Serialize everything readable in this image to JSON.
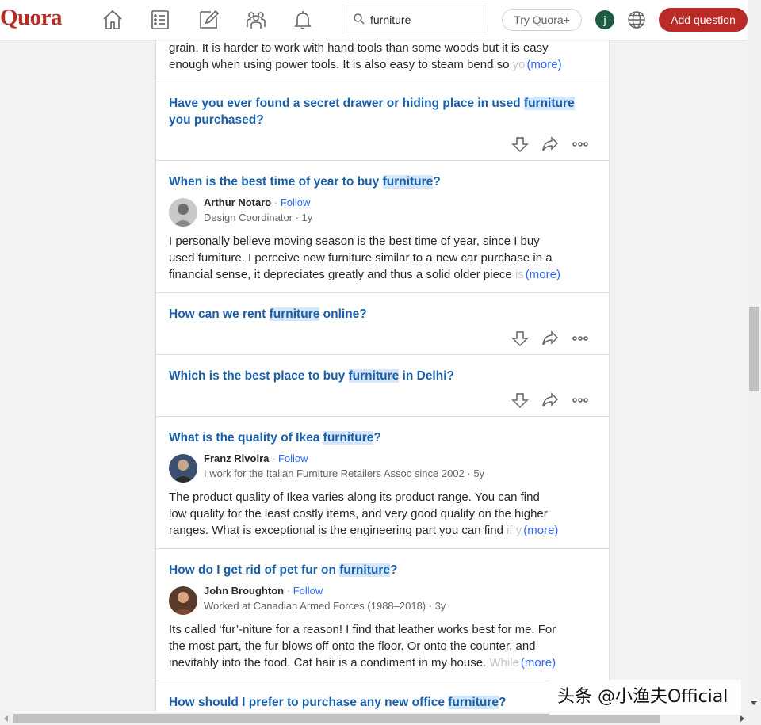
{
  "header": {
    "logo": "Quora",
    "nav_icons": [
      "home-icon",
      "following-icon",
      "answer-icon",
      "spaces-icon",
      "notifications-icon"
    ],
    "search": {
      "value": "furniture"
    },
    "try_label": "Try Quora+",
    "avatar_letter": "j",
    "add_question_label": "Add question",
    "colors": {
      "brand": "#b92b27",
      "link": "#195faa",
      "follow": "#2e69ff",
      "highlight": "#d6e6fb"
    }
  },
  "feed": {
    "top_snippet": {
      "line1": "grain. It is harder to work with hand tools than some woods but it is easy",
      "line2": "enough when using power tools. It is also easy to steam bend so ",
      "fade": "yo",
      "more": "(more)"
    },
    "items": [
      {
        "pre": "Have you ever found a secret drawer or hiding place in used ",
        "hl": "furniture",
        "post": " you purchased?"
      },
      {
        "pre": "When is the best time of year to buy ",
        "hl": "furniture",
        "post": "?",
        "author": "Arthur Notaro",
        "follow": "Follow",
        "cred": "Design Coordinator · 1y",
        "line1": "I personally believe moving season is the best time of year, since I buy",
        "line2": "used furniture. I perceive new furniture similar to a new car purchase in a",
        "line3": "financial sense, it depreciates greatly and thus a solid older piece ",
        "fade": "is",
        "more": "(more)"
      },
      {
        "pre": "How can we rent ",
        "hl": "furniture",
        "post": " online?"
      },
      {
        "pre": "Which is the best place to buy ",
        "hl": "furniture",
        "post": " in Delhi?"
      },
      {
        "pre": "What is the quality of Ikea ",
        "hl": "furniture",
        "post": "?",
        "author": "Franz Rivoira",
        "follow": "Follow",
        "cred": "I work for the Italian Furniture Retailers Assoc since 2002 · 5y",
        "line1": "The product quality of Ikea varies along its product range. You can find",
        "line2": "low quality for the least costly items, and very good quality on the higher",
        "line3": "ranges. What is exceptional is the engineering part you can find ",
        "fade": "if y",
        "more": "(more)"
      },
      {
        "pre": "How do I get rid of pet fur on ",
        "hl": "furniture",
        "post": "?",
        "author": "John Broughton",
        "follow": "Follow",
        "cred": "Worked at Canadian Armed Forces (1988–2018) · 3y",
        "line1": "Its called ‘fur’-niture for a reason! I find that leather works best for me. For",
        "line2": "the most part, the fur blows off onto the floor. Or onto the counter, and",
        "line3": "inevitably into the food. Cat hair is a condiment in my house. ",
        "fade": "While",
        "more": "(more)"
      },
      {
        "pre": "How should I prefer to purchase any new office ",
        "hl": "furniture",
        "post": "?"
      }
    ]
  },
  "watermark": "头条 @小渔夫Official"
}
